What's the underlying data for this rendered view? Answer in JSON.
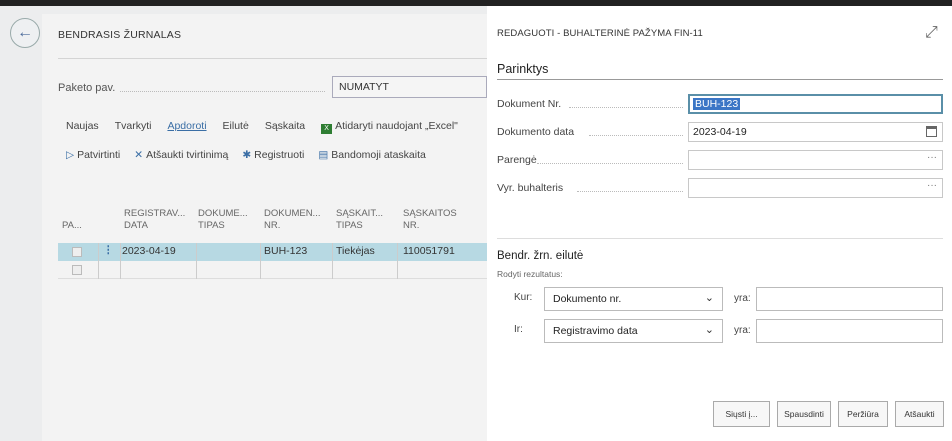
{
  "background": {
    "title": "BENDRASIS ŽURNALAS",
    "paket_label": "Paketo pav.",
    "paket_value": "NUMATYT",
    "menu": [
      "Naujas",
      "Tvarkyti",
      "Apdoroti",
      "Eilutė",
      "Sąskaita"
    ],
    "menu_excel": "Atidaryti naudojant „Excel\"",
    "actions": {
      "confirm": "Patvirtinti",
      "cancel_confirm": "Atšaukti tvirtinimą",
      "register": "Registruoti",
      "test_report": "Bandomoji ataskaita"
    },
    "columns": {
      "pa": "PA...",
      "reg_date": [
        "REGISTRAV...",
        "DATA"
      ],
      "doc_type": [
        "DOKUME...",
        "TIPAS"
      ],
      "doc_no": [
        "DOKUMEN...",
        "NR."
      ],
      "acc_type": [
        "SĄSKAIT...",
        "TIPAS"
      ],
      "acc_no": [
        "SĄSKAITOS",
        "NR."
      ]
    },
    "row": {
      "reg_date": "2023-04-19",
      "doc_no": "BUH-123",
      "acc_type": "Tiekėjas",
      "acc_no": "110051791"
    }
  },
  "dialog": {
    "title": "REDAGUOTI - BUHALTERINĖ PAŽYMA FIN-11",
    "section_options": "Parinktys",
    "fields": {
      "doc_no_label": "Dokument Nr.",
      "doc_no_value": "BUH-123",
      "doc_date_label": "Dokumento data",
      "doc_date_value": "2023-04-19",
      "prepared_label": "Parengė",
      "chief_acc_label": "Vyr. buhalteris"
    },
    "section_lines": "Bendr. žrn. eilutė",
    "show_results": "Rodyti rezultatus:",
    "filter1": {
      "label": "Kur:",
      "field": "Dokumento nr.",
      "op": "yra:"
    },
    "filter2": {
      "label": "Ir:",
      "field": "Registravimo data",
      "op": "yra:"
    },
    "buttons": {
      "send": "Siųsti į...",
      "print": "Spausdinti",
      "preview": "Peržiūra",
      "cancel": "Atšaukti"
    }
  }
}
